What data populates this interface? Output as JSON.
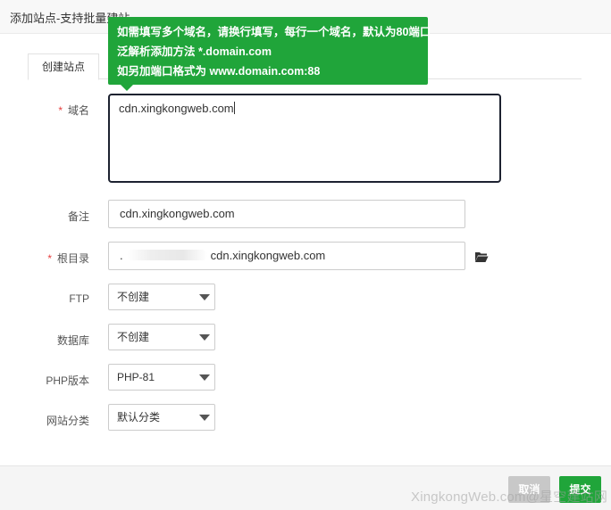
{
  "dialog": {
    "title": "添加站点-支持批量建站"
  },
  "tabs": [
    {
      "label": "创建站点"
    }
  ],
  "tooltip": {
    "lines": [
      "如需填写多个域名，请换行填写，每行一个域名，默认为80端口",
      "泛解析添加方法 *.domain.com",
      "如另加端口格式为 www.domain.com:88"
    ]
  },
  "form": {
    "domain": {
      "label": "域名",
      "required": "*",
      "value": "cdn.xingkongweb.com"
    },
    "remark": {
      "label": "备注",
      "value": "cdn.xingkongweb.com"
    },
    "root": {
      "label": "根目录",
      "required": "*",
      "prefix": ".",
      "value": "cdn.xingkongweb.com",
      "icon": "folder-open-icon"
    },
    "ftp": {
      "label": "FTP",
      "selected": "不创建"
    },
    "database": {
      "label": "数据库",
      "selected": "不创建"
    },
    "php": {
      "label": "PHP版本",
      "selected": "PHP-81"
    },
    "category": {
      "label": "网站分类",
      "selected": "默认分类"
    }
  },
  "footer": {
    "cancel_label": "取消",
    "submit_label": "提交"
  },
  "watermark": "XingkongWeb.com@星空建站网",
  "colors": {
    "accent": "#20a53a",
    "required": "#e6403f",
    "cancel": "#c8c8c8"
  }
}
